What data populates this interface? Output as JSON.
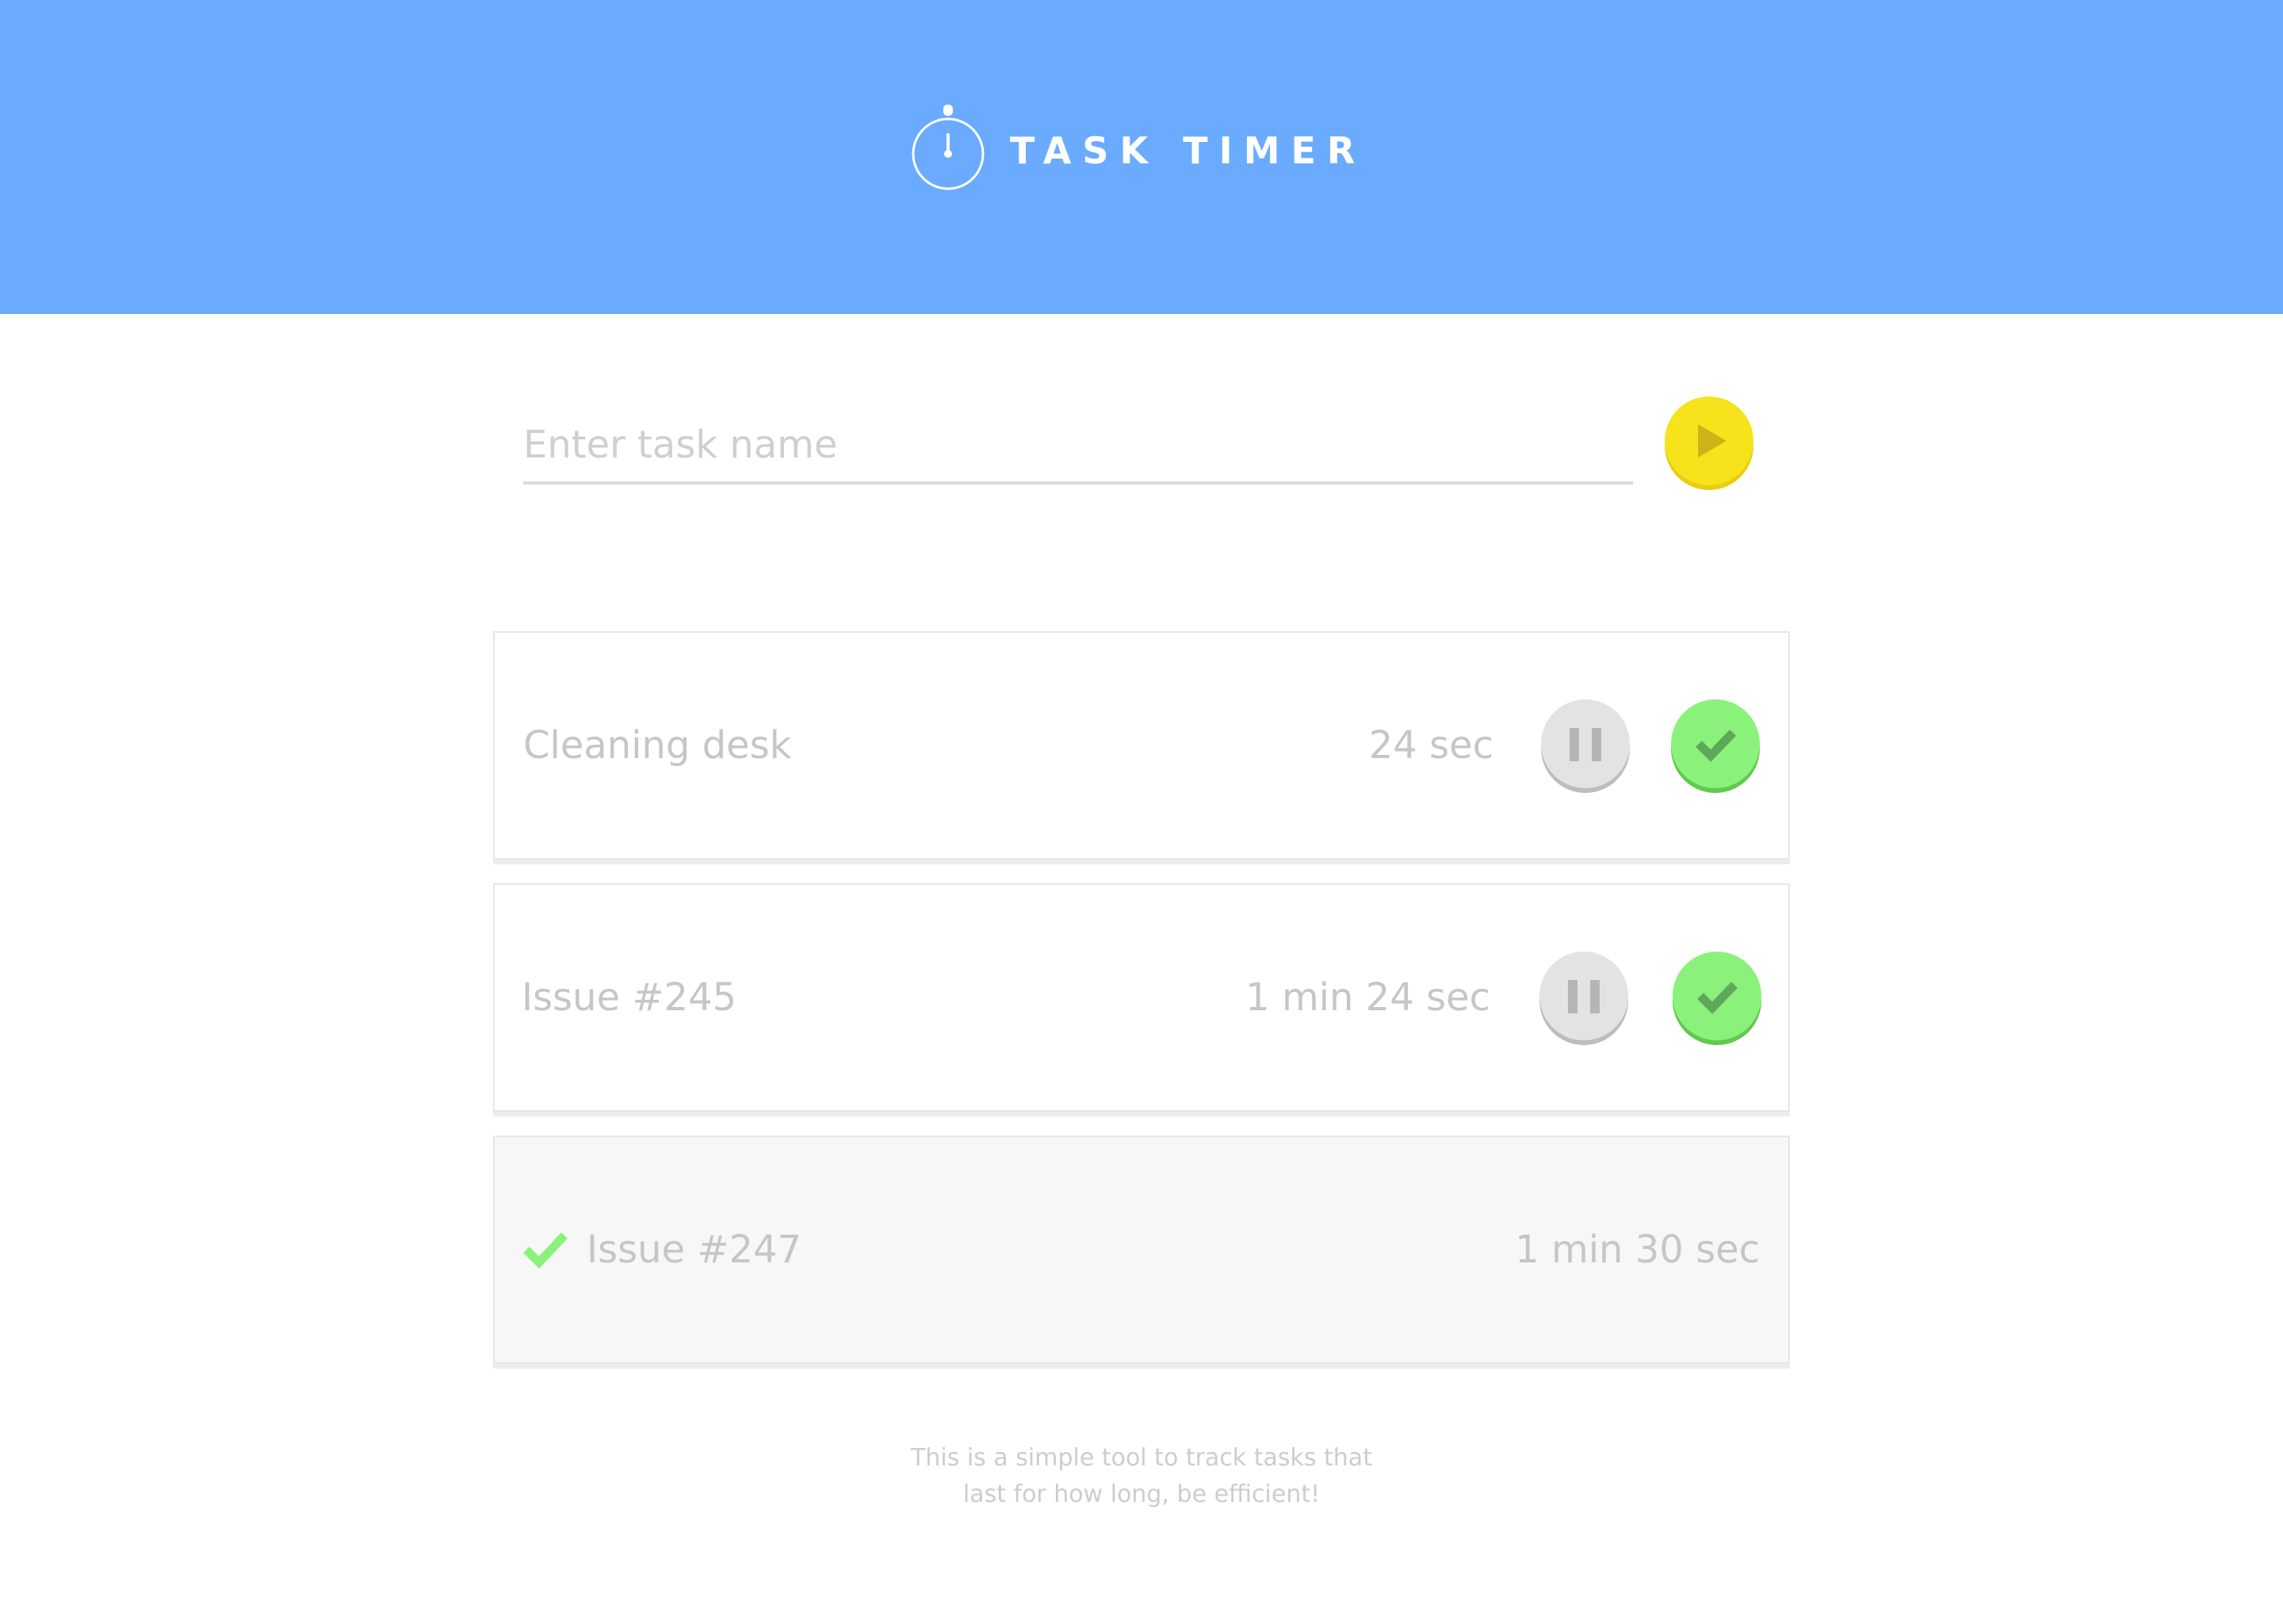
{
  "colors": {
    "header_bg": "#6aabff",
    "accent_yellow": "#f7e31c",
    "accent_green": "#8af27a",
    "pause_gray": "#e3e3e3",
    "text_light": "#c6c6c6"
  },
  "header": {
    "title": "TASK TIMER",
    "icon": "stopwatch-icon"
  },
  "input": {
    "placeholder": "Enter task name",
    "value": "",
    "start_icon": "play-icon"
  },
  "tasks": [
    {
      "name": "Cleaning desk",
      "time": "24 sec",
      "status": "running",
      "pause_icon": "pause-icon",
      "done_icon": "check-icon"
    },
    {
      "name": "Issue #245",
      "time": "1 min 24 sec",
      "status": "running",
      "pause_icon": "pause-icon",
      "done_icon": "check-icon"
    },
    {
      "name": "Issue #247",
      "time": "1 min 30 sec",
      "status": "done",
      "done_icon": "check-icon"
    }
  ],
  "footer": {
    "line1": "This is a simple tool to track tasks that",
    "line2": "last for how long, be efficient!"
  }
}
